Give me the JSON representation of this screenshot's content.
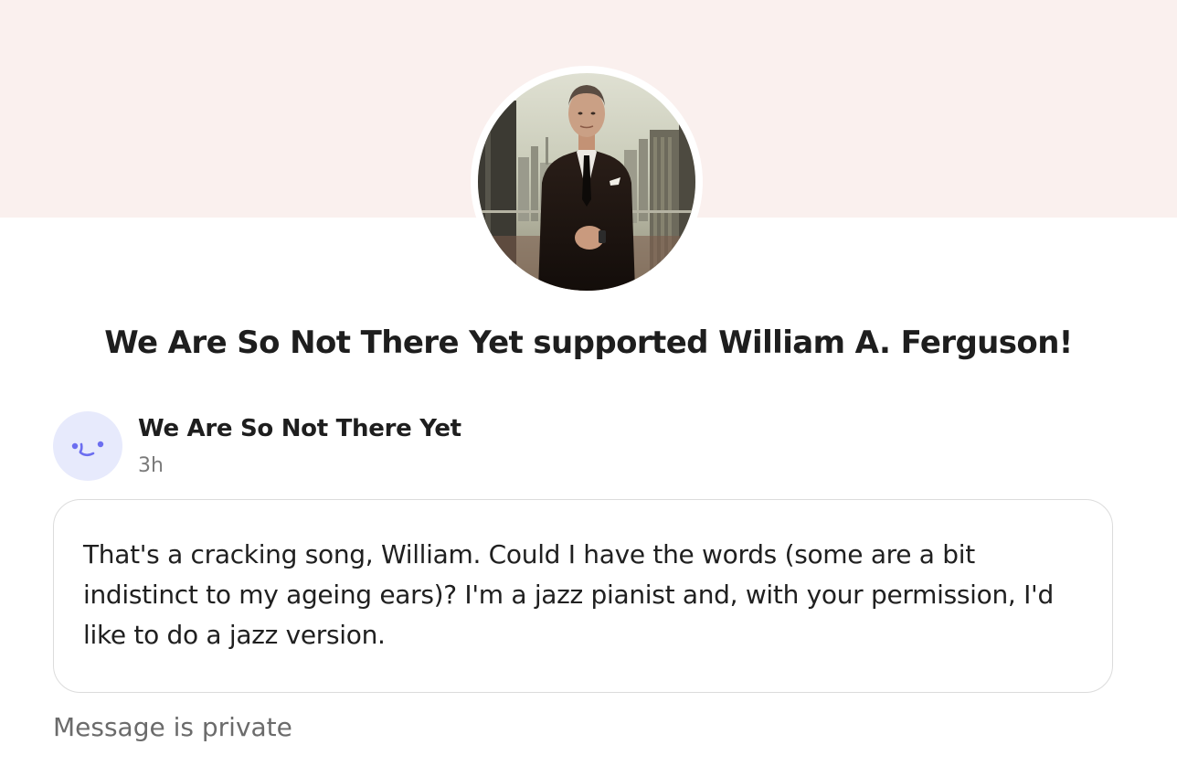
{
  "header": {
    "cover_color": "#faf0ee",
    "profile_photo": "creator-photo"
  },
  "headline": "We Are So Not There Yet supported William A. Ferguson!",
  "supporter": {
    "avatar_icon": "smiley-face-icon",
    "avatar_color": "#e7eafc",
    "name": "We Are So Not There Yet",
    "time": "3h"
  },
  "message": {
    "text": "That's a cracking song, William. Could I have the words (some are a bit indistinct to my ageing ears)? I'm a jazz pianist and, with your permission, I'd like to do a jazz version."
  },
  "privacy_note": "Message is private"
}
